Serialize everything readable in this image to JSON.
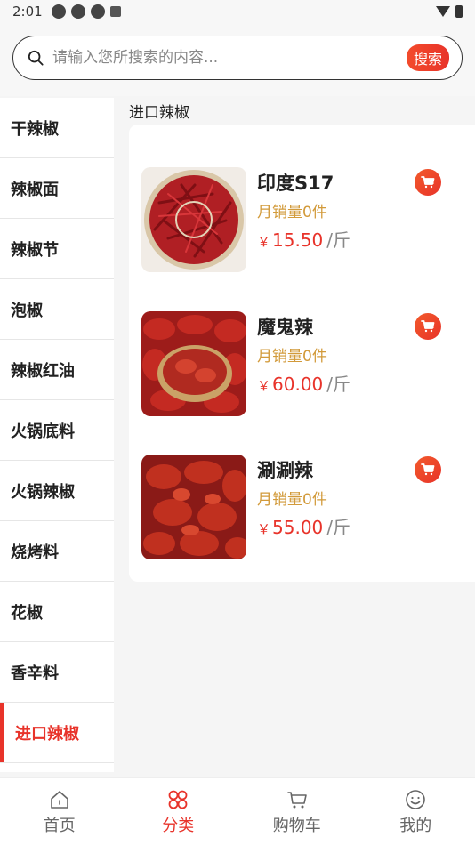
{
  "status_bar": {
    "time": "2:01"
  },
  "search": {
    "placeholder": "请输入您所搜索的内容...",
    "button_label": "搜索"
  },
  "sidebar": {
    "items": [
      {
        "label": "干辣椒",
        "active": false
      },
      {
        "label": "辣椒面",
        "active": false
      },
      {
        "label": "辣椒节",
        "active": false
      },
      {
        "label": "泡椒",
        "active": false
      },
      {
        "label": "辣椒红油",
        "active": false
      },
      {
        "label": "火锅底料",
        "active": false
      },
      {
        "label": "火锅辣椒",
        "active": false
      },
      {
        "label": "烧烤料",
        "active": false
      },
      {
        "label": "花椒",
        "active": false
      },
      {
        "label": "香辛料",
        "active": false
      },
      {
        "label": "进口辣椒",
        "active": true
      }
    ]
  },
  "main": {
    "section_title": "进口辣椒",
    "products": [
      {
        "name": "印度S17",
        "sales": "月销量0件",
        "currency": "￥",
        "price": "15.50",
        "unit": "/斤"
      },
      {
        "name": "魔鬼辣",
        "sales": "月销量0件",
        "currency": "￥",
        "price": "60.00",
        "unit": "/斤"
      },
      {
        "name": "涮涮辣",
        "sales": "月销量0件",
        "currency": "￥",
        "price": "55.00",
        "unit": "/斤"
      }
    ]
  },
  "tabbar": {
    "tabs": [
      {
        "label": "首页",
        "icon": "home-icon",
        "active": false
      },
      {
        "label": "分类",
        "icon": "category-icon",
        "active": true
      },
      {
        "label": "购物车",
        "icon": "cart-icon",
        "active": false
      },
      {
        "label": "我的",
        "icon": "profile-icon",
        "active": false
      }
    ]
  },
  "colors": {
    "accent": "#e8332a",
    "sales": "#d29a3a"
  }
}
